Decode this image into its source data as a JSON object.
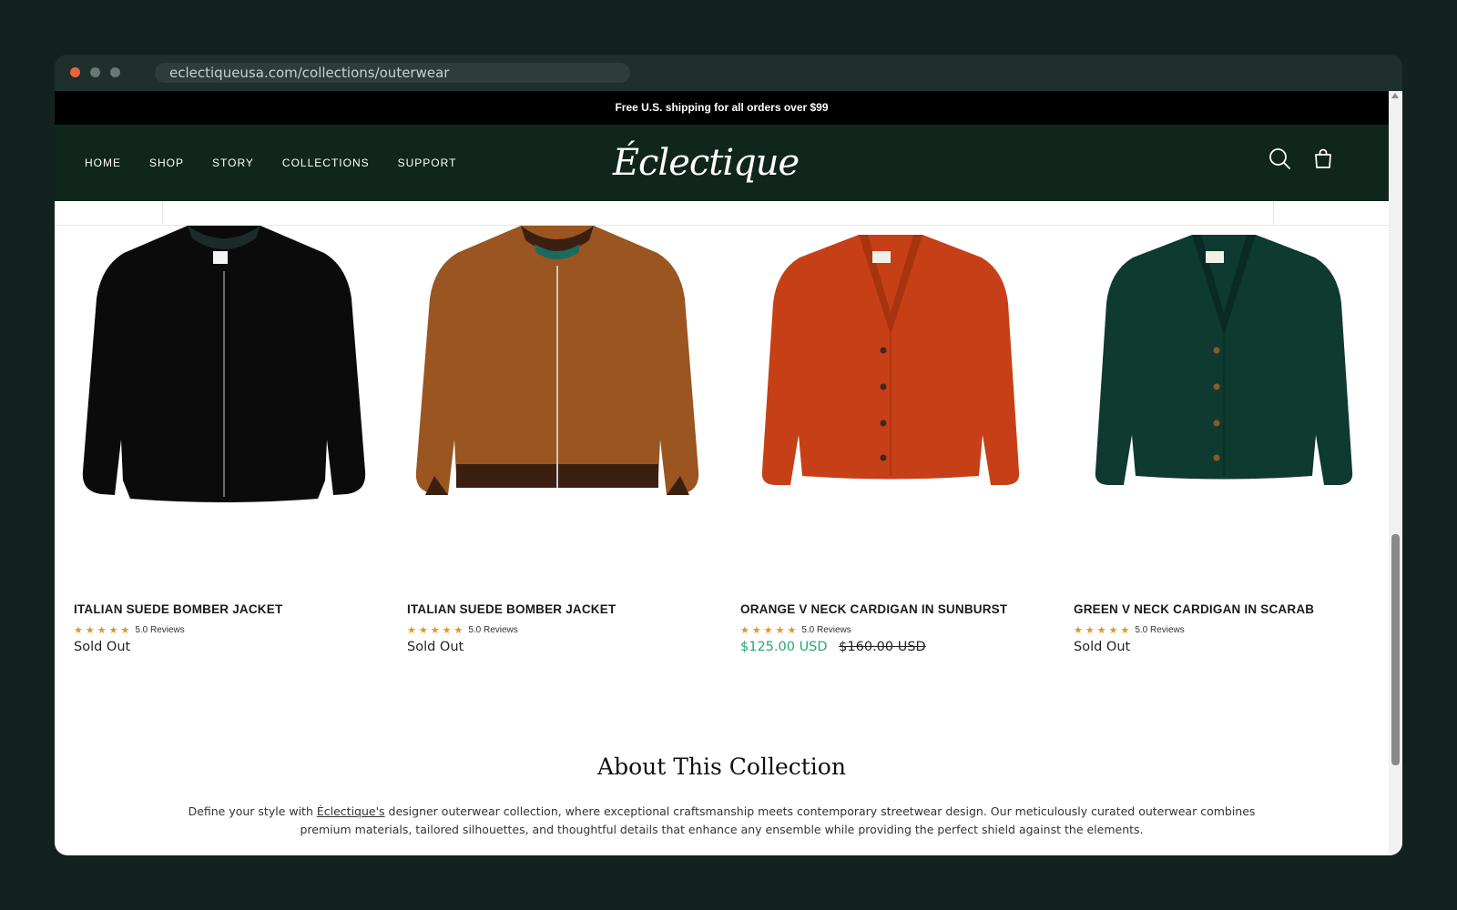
{
  "browser": {
    "url": "eclectiqueusa.com/collections/outerwear"
  },
  "announcement": "Free U.S. shipping for all orders over $99",
  "nav": {
    "items": [
      "HOME",
      "SHOP",
      "STORY",
      "COLLECTIONS",
      "SUPPORT"
    ],
    "logo": "Éclectique",
    "icons": [
      "search-icon",
      "cart-icon"
    ]
  },
  "products": [
    {
      "name": "ITALIAN SUEDE BOMBER JACKET",
      "stars": "★★★★★",
      "reviews": "5.0 Reviews",
      "price": "Sold Out",
      "sale_price": "",
      "compare_price": "",
      "color": "#0b0b0b"
    },
    {
      "name": "ITALIAN SUEDE BOMBER JACKET",
      "stars": "★★★★★",
      "reviews": "5.0 Reviews",
      "price": "Sold Out",
      "sale_price": "",
      "compare_price": "",
      "color": "#9a5520"
    },
    {
      "name": "ORANGE V NECK CARDIGAN IN SUNBURST",
      "stars": "★★★★★",
      "reviews": "5.0 Reviews",
      "price": "",
      "sale_price": "$125.00 USD",
      "compare_price": "$160.00 USD",
      "color": "#c73f17"
    },
    {
      "name": "GREEN V NECK CARDIGAN IN SCARAB",
      "stars": "★★★★★",
      "reviews": "5.0 Reviews",
      "price": "Sold Out",
      "sale_price": "",
      "compare_price": "",
      "color": "#0e3a30"
    }
  ],
  "about": {
    "title": "About This Collection",
    "text_before": "Define your style with ",
    "link": "Éclectique's",
    "text_after": " designer outerwear collection, where exceptional craftsmanship meets contemporary streetwear design. Our meticulously curated outerwear combines premium materials, tailored silhouettes, and thoughtful details that enhance any ensemble while providing the perfect shield against the elements."
  },
  "colors": {
    "header_bg": "#10261c",
    "announcement_bg": "#000000",
    "star": "#e0952b",
    "sale_price": "#2aa66a"
  }
}
